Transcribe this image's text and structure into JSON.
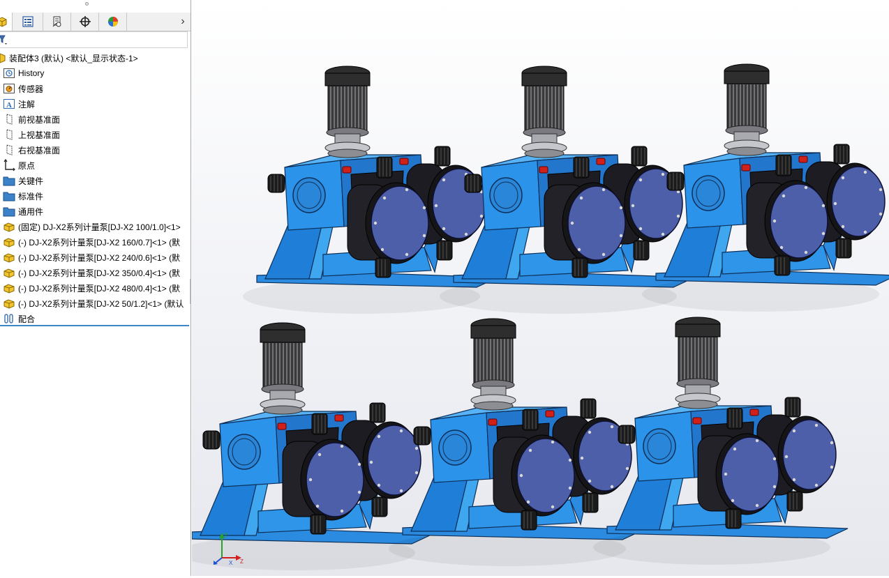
{
  "tabs": [
    {
      "name": "feature-manager-tab",
      "icon": "feature-manager-icon",
      "active": true
    },
    {
      "name": "property-manager-tab",
      "icon": "property-manager-icon",
      "active": false
    },
    {
      "name": "configuration-manager-tab",
      "icon": "configuration-manager-icon",
      "active": false
    },
    {
      "name": "dimxpert-manager-tab",
      "icon": "dimxpert-crosshair-icon",
      "active": false
    },
    {
      "name": "display-manager-tab",
      "icon": "display-manager-pie-icon",
      "active": false
    }
  ],
  "tab_more_glyph": "›",
  "tree": {
    "root": "装配体3 (默认) <默认_显示状态-1>",
    "items": [
      {
        "label": "History",
        "icon": "history-icon"
      },
      {
        "label": "传感器",
        "icon": "sensor-icon"
      },
      {
        "label": "注解",
        "icon": "annotation-icon"
      },
      {
        "label": "前视基准面",
        "icon": "plane-icon"
      },
      {
        "label": "上视基准面",
        "icon": "plane-icon"
      },
      {
        "label": "右视基准面",
        "icon": "plane-icon"
      },
      {
        "label": "原点",
        "icon": "origin-icon"
      },
      {
        "label": "关键件",
        "icon": "folder-icon"
      },
      {
        "label": "标准件",
        "icon": "folder-icon"
      },
      {
        "label": "通用件",
        "icon": "folder-icon"
      },
      {
        "label": "(固定) DJ-X2系列计量泵[DJ-X2 100/1.0]<1>",
        "icon": "part-icon"
      },
      {
        "label": "(-) DJ-X2系列计量泵[DJ-X2 160/0.7]<1> (默",
        "icon": "part-icon"
      },
      {
        "label": "(-) DJ-X2系列计量泵[DJ-X2 240/0.6]<1> (默",
        "icon": "part-icon"
      },
      {
        "label": "(-) DJ-X2系列计量泵[DJ-X2 350/0.4]<1> (默",
        "icon": "part-icon"
      },
      {
        "label": "(-) DJ-X2系列计量泵[DJ-X2 480/0.4]<1> (默",
        "icon": "part-icon"
      },
      {
        "label": "(-) DJ-X2系列计量泵[DJ-X2 50/1.2]<1> (默认",
        "icon": "part-icon"
      },
      {
        "label": "配合",
        "icon": "mates-icon"
      }
    ]
  },
  "viewport": {
    "model": "6 x DJ-X2 metering pump assemblies",
    "triad_labels": {
      "x": "X",
      "y": "Y",
      "z": "Z"
    },
    "colors": {
      "pump_body": "#2f8fe0",
      "motor": "#2a2a2a",
      "head_dark": "#1e1e24",
      "head_plate": "#4d5fa8",
      "base": "#2b8be0"
    }
  }
}
